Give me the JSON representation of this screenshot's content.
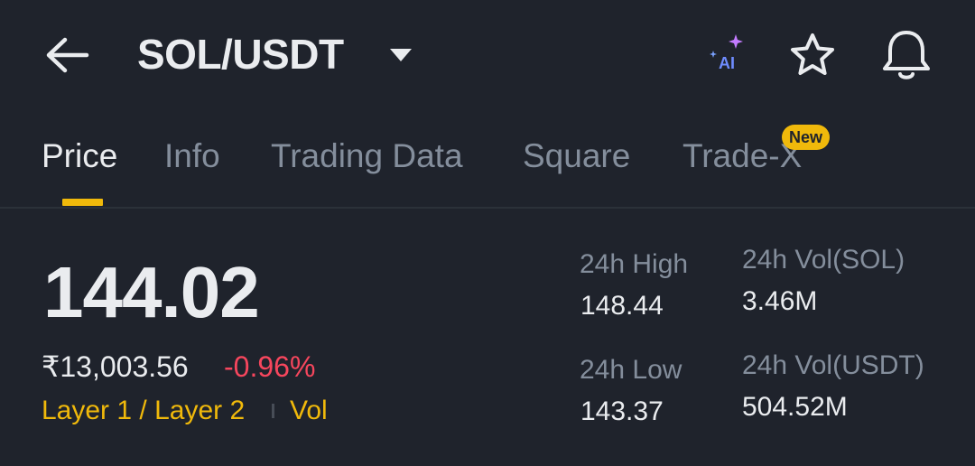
{
  "header": {
    "pair": "SOL/USDT",
    "ai_label": "AI"
  },
  "tabs": [
    {
      "label": "Price",
      "active": true
    },
    {
      "label": "Info"
    },
    {
      "label": "Trading Data"
    },
    {
      "label": "Square"
    },
    {
      "label": "Trade-X",
      "badge": "New"
    }
  ],
  "price": {
    "last": "144.02",
    "fiat": "₹13,003.56",
    "change": "-0.96%"
  },
  "tags": {
    "category": "Layer 1 / Layer 2",
    "vol": "Vol"
  },
  "stats": {
    "high_label": "24h High",
    "high_value": "148.44",
    "low_label": "24h Low",
    "low_value": "143.37",
    "vol_base_label": "24h Vol(SOL)",
    "vol_base_value": "3.46M",
    "vol_quote_label": "24h Vol(USDT)",
    "vol_quote_value": "504.52M"
  },
  "icons": {
    "back": "arrow-left-icon",
    "dropdown": "caret-down-icon",
    "ai": "ai-sparkle-icon",
    "favorite": "star-icon",
    "alert": "bell-icon"
  },
  "colors": {
    "background": "#1f232c",
    "text_primary": "#eaecef",
    "text_secondary": "#848e9c",
    "accent_yellow": "#f0b90b",
    "negative_red": "#f6465d",
    "ai_blue": "#6f8cff"
  }
}
